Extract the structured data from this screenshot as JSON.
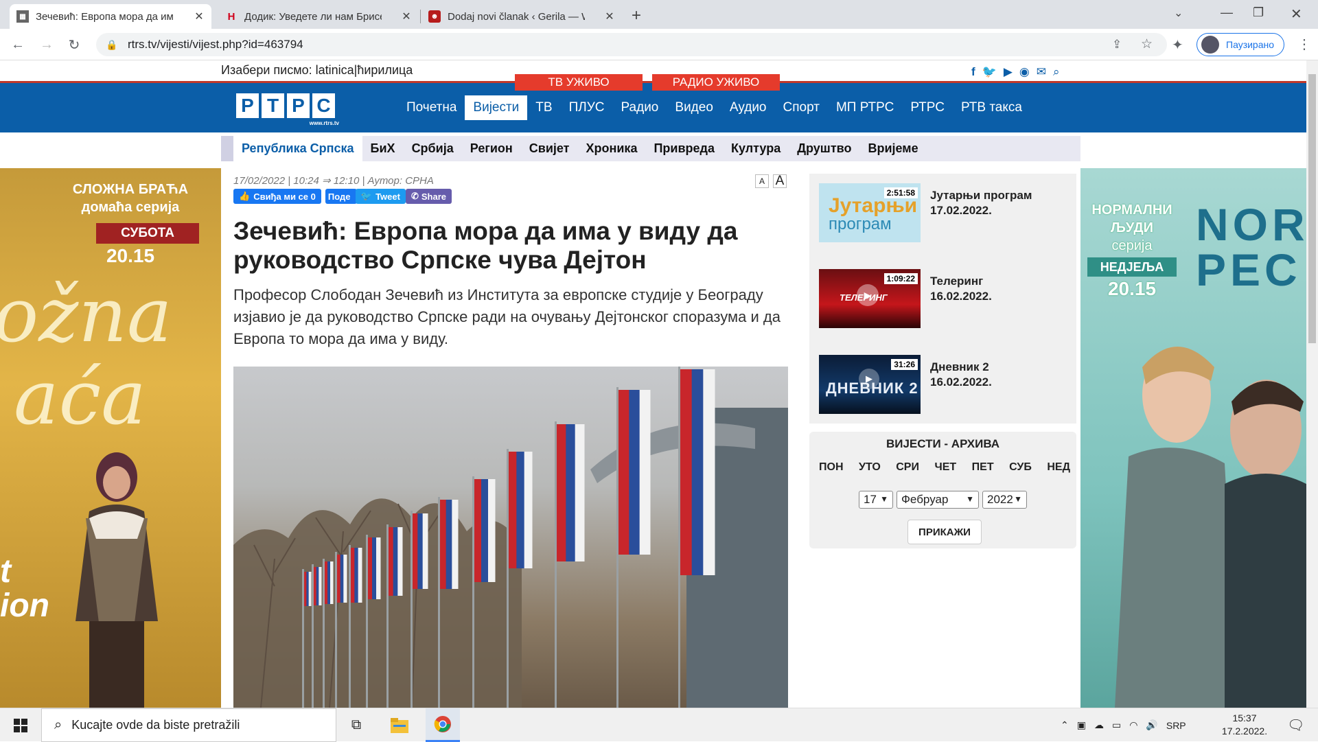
{
  "browser": {
    "tabs": [
      {
        "title": "Зечевић: Европа мора да има у"
      },
      {
        "title": "Додик: Уведете ли нам Брисел с"
      },
      {
        "title": "Dodaj novi članak ‹ Gerila — Wo"
      }
    ],
    "url": "rtrs.tv/vijesti/vijest.php?id=463794",
    "profile": "Паузирано"
  },
  "site": {
    "script_label": "Изабери писмо:",
    "script_latin": "latinica",
    "script_sep": "|",
    "script_cyr": "ћирилица",
    "live_tv": "ТВ УЖИВО",
    "live_radio": "РАДИО УЖИВО",
    "logo_letters": [
      "Р",
      "Т",
      "Р",
      "С"
    ],
    "logo_url": "www.rtrs.tv",
    "menu": [
      "Почетна",
      "Вијести",
      "ТВ",
      "ПЛУС",
      "Радио",
      "Видео",
      "Аудио",
      "Спорт",
      "МП РТРС",
      "РТРС",
      "РТВ такса"
    ],
    "menu_active": 1,
    "subnav": [
      "Република Српска",
      "БиХ",
      "Србија",
      "Регион",
      "Свијет",
      "Хроника",
      "Привреда",
      "Култура",
      "Друштво",
      "Вријеме"
    ],
    "subnav_active": 0
  },
  "ad_left": {
    "line1": "СЛОЖНА БРАЋА",
    "line2": "домаћа серија",
    "badge": "СУБОТА",
    "time": "20.15",
    "art1": "ožna",
    "art2": "aća",
    "art3": "t",
    "art4": "ion"
  },
  "ad_right": {
    "line1": "НОРМАЛНИ",
    "line2": "ЉУДИ",
    "line3": "серија",
    "badge": "НЕДЈЕЉА",
    "time": "20.15",
    "big1": "NOR",
    "big2": "PEC"
  },
  "article": {
    "meta": "17/02/2022 |  10:24 ⇒ 12:10 | Аутор: СРНА",
    "font_small": "A",
    "font_large": "A",
    "like_label": "Свиђа ми се 0",
    "share_fb": "Поде",
    "tweet": "Tweet",
    "share_viber": "Share",
    "title": "Зечевић: Европа мора да има у виду да руководство Српске чува Дејтон",
    "lead": "Професор Слободан Зечевић из Института за европске студије у Београду изјавио је да руководство Српске ради на очувању Дејтонског споразума и да Европа то мора да има у виду."
  },
  "videos": [
    {
      "title": "Јутарњи програм",
      "date": "17.02.2022.",
      "duration": "2:51:58",
      "thumb_text1": "Јутарњи",
      "thumb_text2": "програм"
    },
    {
      "title": "Теле­ринг",
      "date": "16.02.2022.",
      "duration": "1:09:22",
      "thumb_text1": "ТЕЛЕРИНГ",
      "thumb_text2": ""
    },
    {
      "title": "Дневник 2",
      "date": "16.02.2022.",
      "duration": "31:26",
      "thumb_text1": "ДНЕВНИК 2",
      "thumb_text2": ""
    }
  ],
  "archive": {
    "header": "ВИЈЕСТИ - АРХИВА",
    "days": [
      "ПОН",
      "УТО",
      "СРИ",
      "ЧЕТ",
      "ПЕТ",
      "СУБ",
      "НЕД"
    ],
    "day_value": "17",
    "month_value": "Фебруар",
    "year_value": "2022",
    "button": "ПРИКАЖИ"
  },
  "taskbar": {
    "search_placeholder": "Kucajte ovde da biste pretražili",
    "lang": "SRP",
    "time": "15:37",
    "date": "17.2.2022."
  },
  "colors": {
    "brand": "#0b5ea8",
    "live": "#e53b2c"
  }
}
